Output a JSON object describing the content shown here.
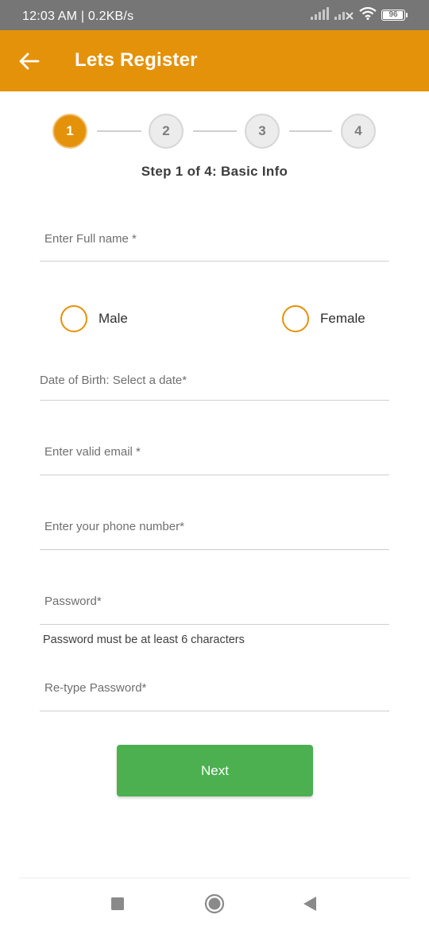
{
  "status_bar": {
    "time_speed": "12:03 AM | 0.2KB/s",
    "battery_level": "96",
    "battery_fraction": 0.96
  },
  "app_bar": {
    "title": "Lets Register",
    "back_icon": "arrow-left-icon",
    "background_color": "#e4920a"
  },
  "stepper": {
    "steps": [
      "1",
      "2",
      "3",
      "4"
    ],
    "current_step": 1,
    "caption": "Step 1 of 4: Basic Info"
  },
  "form": {
    "full_name_placeholder": "Enter Full name *",
    "gender_options": [
      "Male",
      "Female"
    ],
    "dob_label": "Date of Birth: Select a date*",
    "email_placeholder": "Enter valid email *",
    "phone_placeholder": "Enter your phone number*",
    "password_placeholder": "Password*",
    "password_helper": "Password must be at least 6 characters",
    "retype_password_placeholder": "Re-type Password*"
  },
  "actions": {
    "next_label": "Next",
    "next_color": "#4caf50"
  },
  "nav_bar": {
    "icons": [
      "square-recents-icon",
      "circle-home-icon",
      "triangle-back-icon"
    ]
  }
}
